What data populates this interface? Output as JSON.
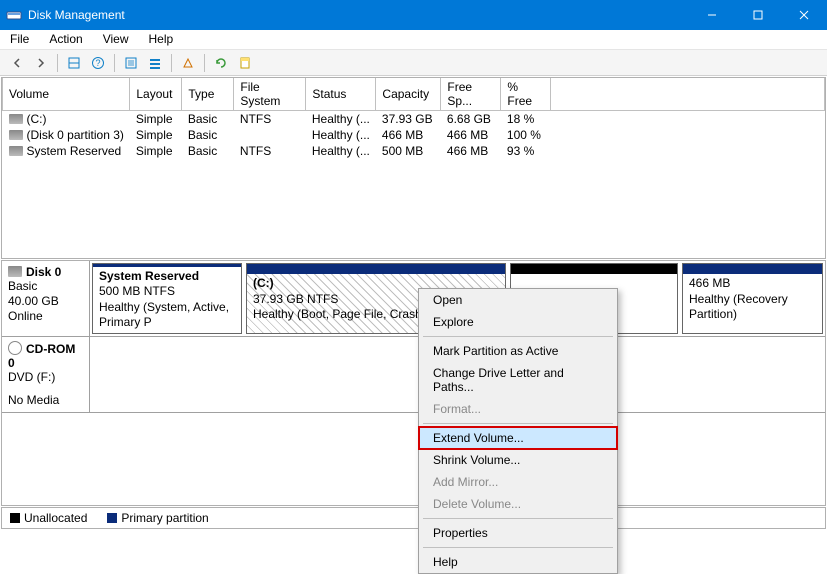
{
  "window": {
    "title": "Disk Management"
  },
  "menubar": [
    "File",
    "Action",
    "View",
    "Help"
  ],
  "table": {
    "columns": [
      "Volume",
      "Layout",
      "Type",
      "File System",
      "Status",
      "Capacity",
      "Free Sp...",
      "% Free"
    ],
    "rows": [
      {
        "volume": "(C:)",
        "layout": "Simple",
        "type": "Basic",
        "fs": "NTFS",
        "status": "Healthy (...",
        "capacity": "37.93 GB",
        "free": "6.68 GB",
        "pct": "18 %"
      },
      {
        "volume": "(Disk 0 partition 3)",
        "layout": "Simple",
        "type": "Basic",
        "fs": "",
        "status": "Healthy (...",
        "capacity": "466 MB",
        "free": "466 MB",
        "pct": "100 %"
      },
      {
        "volume": "System Reserved",
        "layout": "Simple",
        "type": "Basic",
        "fs": "NTFS",
        "status": "Healthy (...",
        "capacity": "500 MB",
        "free": "466 MB",
        "pct": "93 %"
      }
    ]
  },
  "disk0": {
    "name": "Disk 0",
    "type": "Basic",
    "cap": "40.00 GB",
    "state": "Online",
    "p0": {
      "name": "System Reserved",
      "line2": "500 MB NTFS",
      "line3": "Healthy (System, Active, Primary P"
    },
    "p1": {
      "name": "(C:)",
      "line2": "37.93 GB NTFS",
      "line3": "Healthy (Boot, Page File, Crash Dump, P"
    },
    "p2": {
      "name": "",
      "line2": "",
      "line3": ""
    },
    "p3": {
      "name": "",
      "line2": "466 MB",
      "line3": "Healthy (Recovery Partition)"
    }
  },
  "cdrom": {
    "name": "CD-ROM 0",
    "path": "DVD (F:)",
    "state": "No Media"
  },
  "legend": {
    "unalloc": "Unallocated",
    "primary": "Primary partition"
  },
  "ctx": {
    "open": "Open",
    "explore": "Explore",
    "mark": "Mark Partition as Active",
    "letter": "Change Drive Letter and Paths...",
    "format": "Format...",
    "extend": "Extend Volume...",
    "shrink": "Shrink Volume...",
    "mirror": "Add Mirror...",
    "delete": "Delete Volume...",
    "props": "Properties",
    "help": "Help"
  }
}
